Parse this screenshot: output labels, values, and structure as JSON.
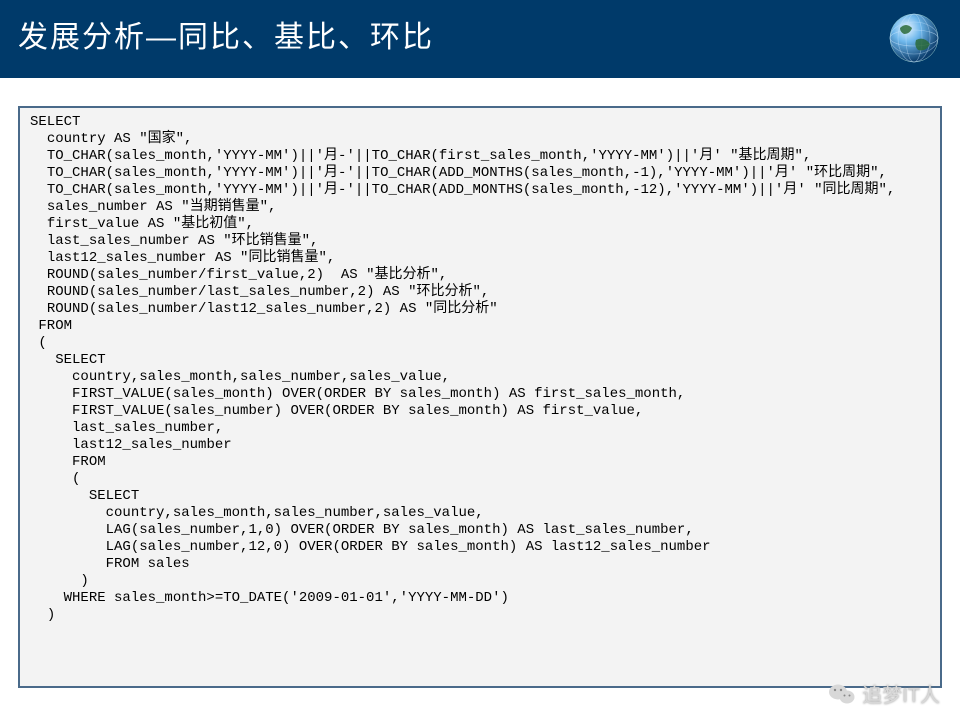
{
  "header": {
    "title": "发展分析—同比、基比、环比"
  },
  "code": "SELECT\n  country AS \"国家\",\n  TO_CHAR(sales_month,'YYYY-MM')||'月-'||TO_CHAR(first_sales_month,'YYYY-MM')||'月' \"基比周期\",\n  TO_CHAR(sales_month,'YYYY-MM')||'月-'||TO_CHAR(ADD_MONTHS(sales_month,-1),'YYYY-MM')||'月' \"环比周期\",\n  TO_CHAR(sales_month,'YYYY-MM')||'月-'||TO_CHAR(ADD_MONTHS(sales_month,-12),'YYYY-MM')||'月' \"同比周期\",\n  sales_number AS \"当期销售量\",\n  first_value AS \"基比初值\",\n  last_sales_number AS \"环比销售量\",\n  last12_sales_number AS \"同比销售量\",\n  ROUND(sales_number/first_value,2)  AS \"基比分析\",\n  ROUND(sales_number/last_sales_number,2) AS \"环比分析\",\n  ROUND(sales_number/last12_sales_number,2) AS \"同比分析\"\n FROM\n (\n   SELECT\n     country,sales_month,sales_number,sales_value,\n     FIRST_VALUE(sales_month) OVER(ORDER BY sales_month) AS first_sales_month,\n     FIRST_VALUE(sales_number) OVER(ORDER BY sales_month) AS first_value,\n     last_sales_number,\n     last12_sales_number\n     FROM\n     (\n       SELECT\n         country,sales_month,sales_number,sales_value,\n         LAG(sales_number,1,0) OVER(ORDER BY sales_month) AS last_sales_number,\n         LAG(sales_number,12,0) OVER(ORDER BY sales_month) AS last12_sales_number\n         FROM sales\n      )\n    WHERE sales_month>=TO_DATE('2009-01-01','YYYY-MM-DD')\n  )",
  "watermark": {
    "label": "追梦IT人"
  }
}
